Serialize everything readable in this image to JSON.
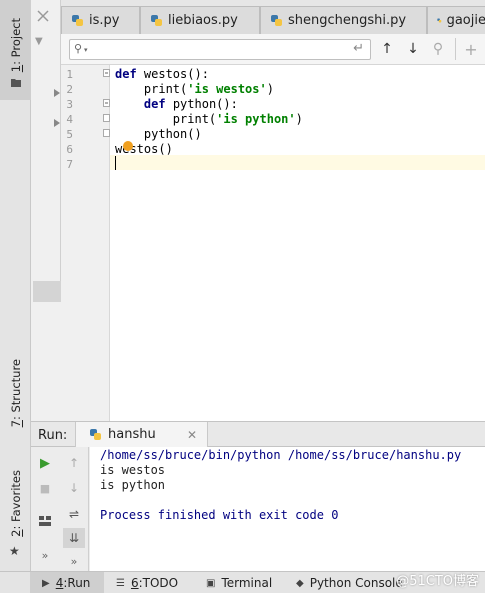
{
  "left_strip": {
    "project_num": "1",
    "project_label": "Project",
    "structure_num": "7",
    "structure_label": "Structure",
    "favorites_num": "2",
    "favorites_label": "Favorites"
  },
  "editor_tabs": [
    {
      "label": "is.py"
    },
    {
      "label": "liebiaos.py"
    },
    {
      "label": "shengchengshi.py"
    },
    {
      "label": "gaojie"
    }
  ],
  "search": {
    "placeholder": ""
  },
  "editor": {
    "line_numbers": [
      "1",
      "2",
      "3",
      "4",
      "5",
      "6",
      "7"
    ],
    "lines": [
      {
        "kw": "def",
        "rest": " westos():"
      },
      {
        "pre": "    print(",
        "str": "'is westos'",
        "post": ")"
      },
      {
        "kw": "def",
        "rest": " python():",
        "indent": "    "
      },
      {
        "pre": "        print(",
        "str": "'is python'",
        "post": ")"
      },
      {
        "text": "    python()"
      },
      {
        "text": "westos()"
      },
      {
        "text": ""
      }
    ]
  },
  "run": {
    "title": "Run:",
    "tab_label": "hanshu",
    "console": [
      {
        "text": "/home/ss/bruce/bin/python /home/ss/bruce/hanshu.py",
        "color": "#000080"
      },
      {
        "text": "is westos",
        "color": "#000000"
      },
      {
        "text": "is python",
        "color": "#000000"
      },
      {
        "text": "",
        "color": "#000000"
      },
      {
        "text": "Process finished with exit code 0",
        "color": "#000080"
      }
    ]
  },
  "bottom_tabs": [
    {
      "num": "4",
      "label": "Run"
    },
    {
      "num": "6",
      "label": "TODO"
    },
    {
      "label": "Terminal"
    },
    {
      "label": "Python Console"
    }
  ],
  "watermark": "@51CTO博客",
  "colors": {
    "keyword": "#000080",
    "string": "#008000",
    "current_line": "#fffae3",
    "run_green": "#3a9b2e"
  }
}
